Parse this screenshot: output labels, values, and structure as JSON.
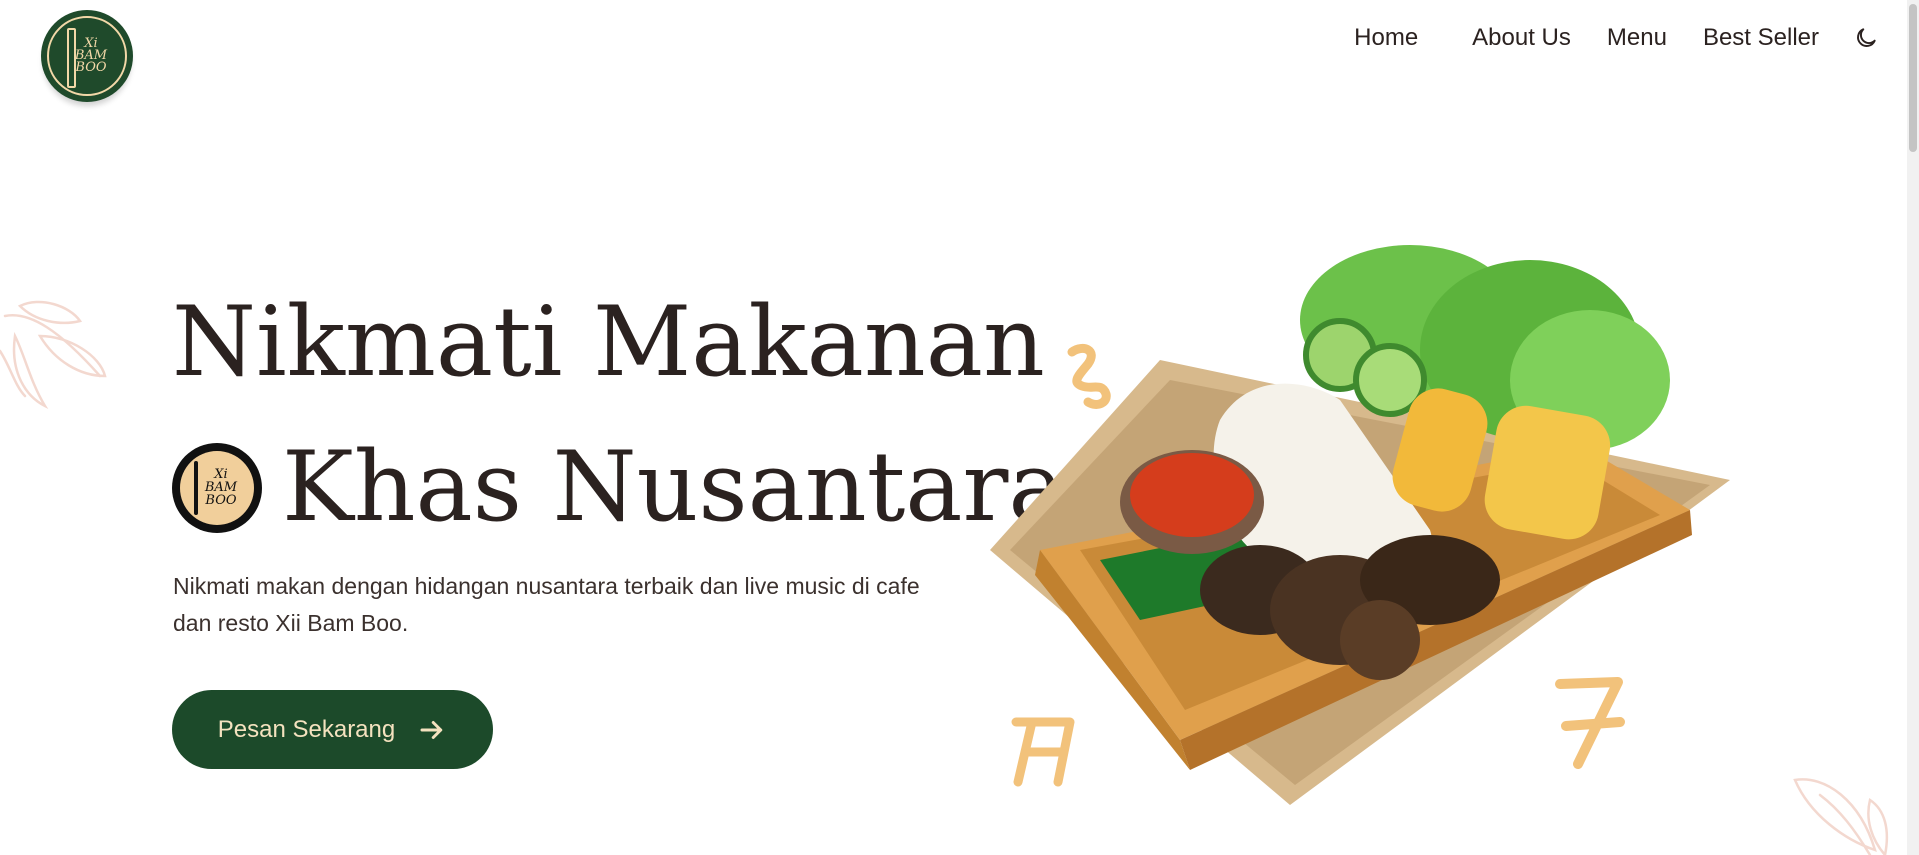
{
  "brand": {
    "logo_text": "Xi BAM BOO"
  },
  "nav": {
    "items": [
      "Home",
      "About Us",
      "Menu",
      "Best Seller"
    ],
    "theme_toggle_icon": "moon-icon"
  },
  "hero": {
    "title_line1": "Nikmati Makanan",
    "title_line2": "Khas Nusantara",
    "description": "Nikmati makan dengan hidangan nusantara terbaik dan live music di cafe dan resto Xii Bam Boo.",
    "cta_label": "Pesan Sekarang",
    "cta_icon": "arrow-right-icon"
  },
  "colors": {
    "brand_green": "#1c4a2a",
    "accent_cream": "#f4e2bf",
    "text_dark": "#2b2220",
    "decor_orange": "#f2c27b"
  }
}
